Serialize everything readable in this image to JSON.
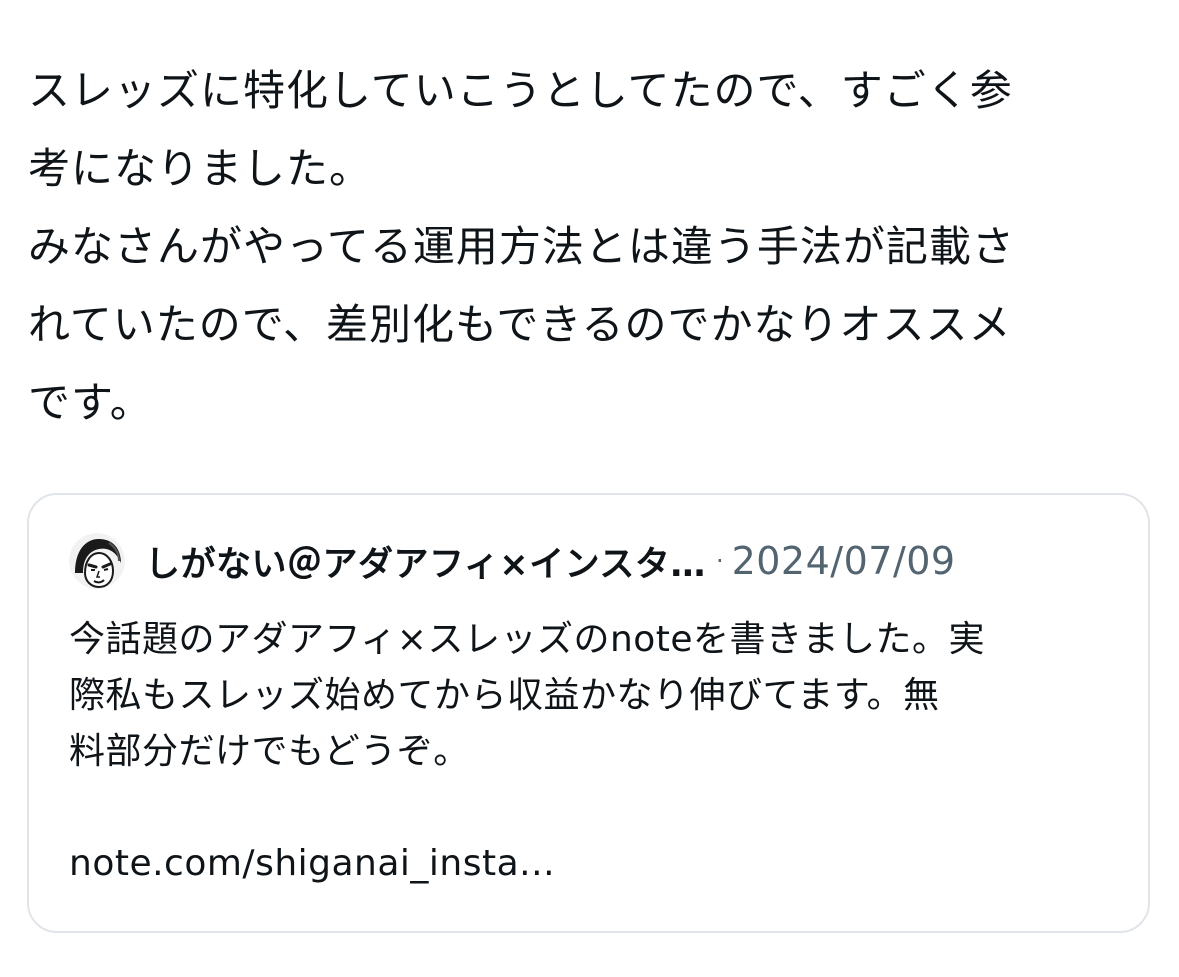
{
  "post": {
    "text_lines": [
      "スレッズに特化していこうとしてたので、すごく参",
      "考になりました。",
      "みなさんがやってる運用方法とは違う手法が記載さ",
      "れていたので、差別化もできるのでかなりオススメ",
      "です。"
    ]
  },
  "quote": {
    "avatar_icon": "avatar-illustration-icon",
    "author_name": "しがない＠アダアフィ×インスタ…",
    "separator": "·",
    "date": "2024/07/09",
    "body_lines": [
      "今話題のアダアフィ×スレッズのnoteを書きました。実",
      "際私もスレッズ始めてから収益かなり伸びてます。無",
      "料部分だけでもどうぞ。"
    ],
    "link_text": "note.com/shiganai_insta..."
  }
}
